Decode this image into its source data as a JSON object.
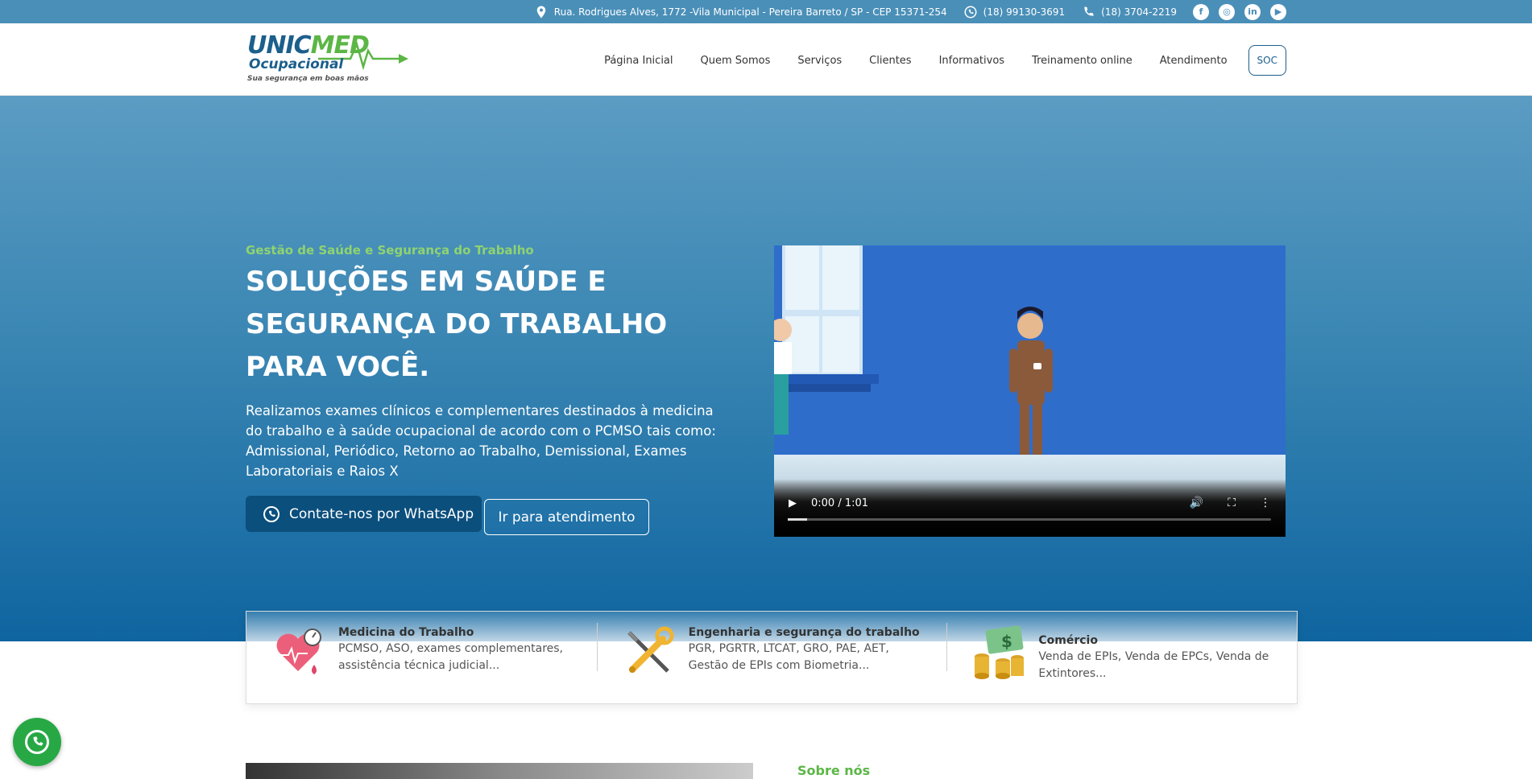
{
  "topbar": {
    "address": "Rua. Rodrigues Alves, 1772 -Vila Municipal - Pereira Barreto / SP - CEP 15371-254",
    "whatsapp": "(18) 99130-3691",
    "phone": "(18) 3704-2219",
    "social": [
      "facebook-icon",
      "instagram-icon",
      "linkedin-icon",
      "youtube-icon"
    ]
  },
  "logo": {
    "line1_a": "UNIC",
    "line1_b": "MED",
    "line2": "Ocupacional",
    "tagline": "Sua segurança em boas mãos"
  },
  "nav": {
    "items": [
      "Página Inicial",
      "Quem Somos",
      "Serviços",
      "Clientes",
      "Informativos",
      "Treinamento online",
      "Atendimento"
    ],
    "cta": "SOC"
  },
  "hero": {
    "eyebrow": "Gestão de Saúde e Segurança do Trabalho",
    "headline": "SOLUÇÕES EM SAÚDE E SEGURANÇA DO TRABALHO PARA VOCÊ.",
    "description": "Realizamos exames clínicos e complementares destinados à medicina do trabalho e à saúde ocupacional de acordo com o PCMSO tais como: Admissional, Periódico, Retorno ao Trabalho, Demissional, Exames Laboratoriais e Raios X",
    "whatsapp_button": "Contate-nos por WhatsApp",
    "attendance_button": "Ir para atendimento"
  },
  "video": {
    "time": "0:00 / 1:01",
    "progress": 0.04
  },
  "features": [
    {
      "title": "Medicina do Trabalho",
      "desc": "PCMSO, ASO, exames complementares, assistência técnica judicial...",
      "icon": "heart-health-icon"
    },
    {
      "title": "Engenharia e segurança do trabalho",
      "desc": "PGR, PGRTR, LTCAT, GRO, PAE, AET, Gestão de EPIs com Biometria...",
      "icon": "tools-icon"
    },
    {
      "title": "Comércio",
      "desc": "Venda de EPIs, Venda de EPCs, Venda de Extintores...",
      "icon": "money-icon"
    }
  ],
  "about": {
    "label": "Sobre nós"
  },
  "colors": {
    "accent_green": "#5cb646",
    "brand_blue": "#1c5f8c",
    "topbar": "#4a8fb8"
  }
}
